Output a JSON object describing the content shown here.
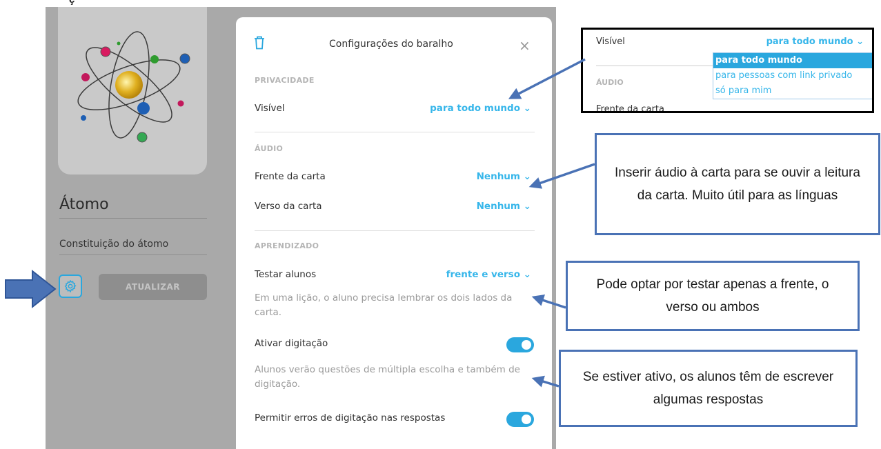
{
  "top_fragment": "ç",
  "deck": {
    "title": "Átomo",
    "description": "Constituição do átomo",
    "update_label": "ATUALIZAR"
  },
  "modal": {
    "title": "Configurações do baralho",
    "close_glyph": "×",
    "privacy": {
      "heading": "PRIVACIDADE",
      "visible_label": "Visível",
      "visible_value": "para todo mundo"
    },
    "audio": {
      "heading": "ÁUDIO",
      "front_label": "Frente da carta",
      "front_value": "Nenhum",
      "back_label": "Verso da carta",
      "back_value": "Nenhum"
    },
    "learning": {
      "heading": "APRENDIZADO",
      "test_label": "Testar alunos",
      "test_value": "frente e verso",
      "test_help": "Em uma lição, o aluno precisa lembrar os dois lados da carta.",
      "typing_label": "Ativar digitação",
      "typing_on": true,
      "typing_help": "Alunos verão questões de múltipla escolha e também de digitação.",
      "typos_label": "Permitir erros de digitação nas respostas",
      "typos_on": true
    }
  },
  "inset": {
    "label": "Visível",
    "value": "para todo mundo",
    "audio_heading": "ÁUDIO",
    "front_label": "Frente da carta",
    "options": [
      "para todo mundo",
      "para pessoas com link privado",
      "só para mim"
    ],
    "selected_index": 0
  },
  "callouts": {
    "audio": "Inserir áudio à carta para se ouvir a leitura da carta. Muito útil para as línguas",
    "test": "Pode optar por testar apenas a frente, o verso ou ambos",
    "typing": "Se estiver ativo, os alunos têm de escrever algumas respostas"
  },
  "colors": {
    "accent": "#2aa7de",
    "value_text": "#36b6ea",
    "annotation": "#4a72b5",
    "overlay": "#a9a9a9"
  },
  "icons": [
    "trash-icon",
    "close-icon",
    "gear-icon",
    "chevron-down-icon",
    "arrow-right-icon",
    "atom-image"
  ]
}
